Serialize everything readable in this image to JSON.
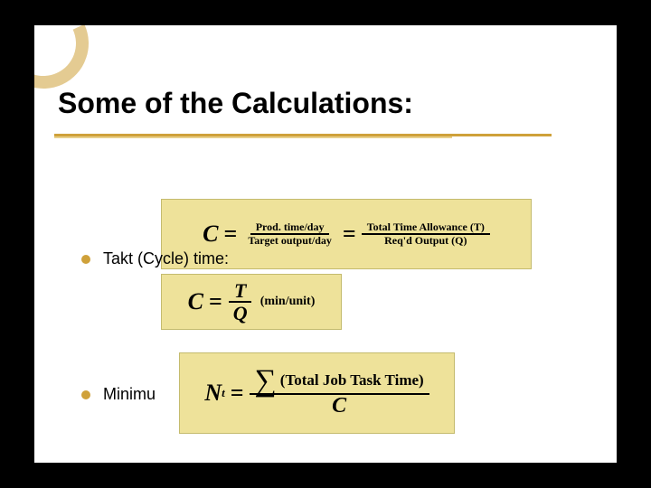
{
  "title": "Some of the Calculations:",
  "bullets": {
    "b1": "Takt (Cycle) time:",
    "b2": "Minimu"
  },
  "formula1": {
    "lhs": "C",
    "frac1_num": "Prod. time/day",
    "frac1_den": "Target output/day",
    "frac2_num": "Total Time Allowance (T)",
    "frac2_den": "Req'd Output (Q)"
  },
  "formula2": {
    "lhs": "C",
    "num_var": "T",
    "den_var": "Q",
    "units": "(min/unit)"
  },
  "formula3": {
    "lhs_var": "N",
    "lhs_sub": "t",
    "sum_label": "(Total Job Task Time)",
    "den": "C"
  }
}
